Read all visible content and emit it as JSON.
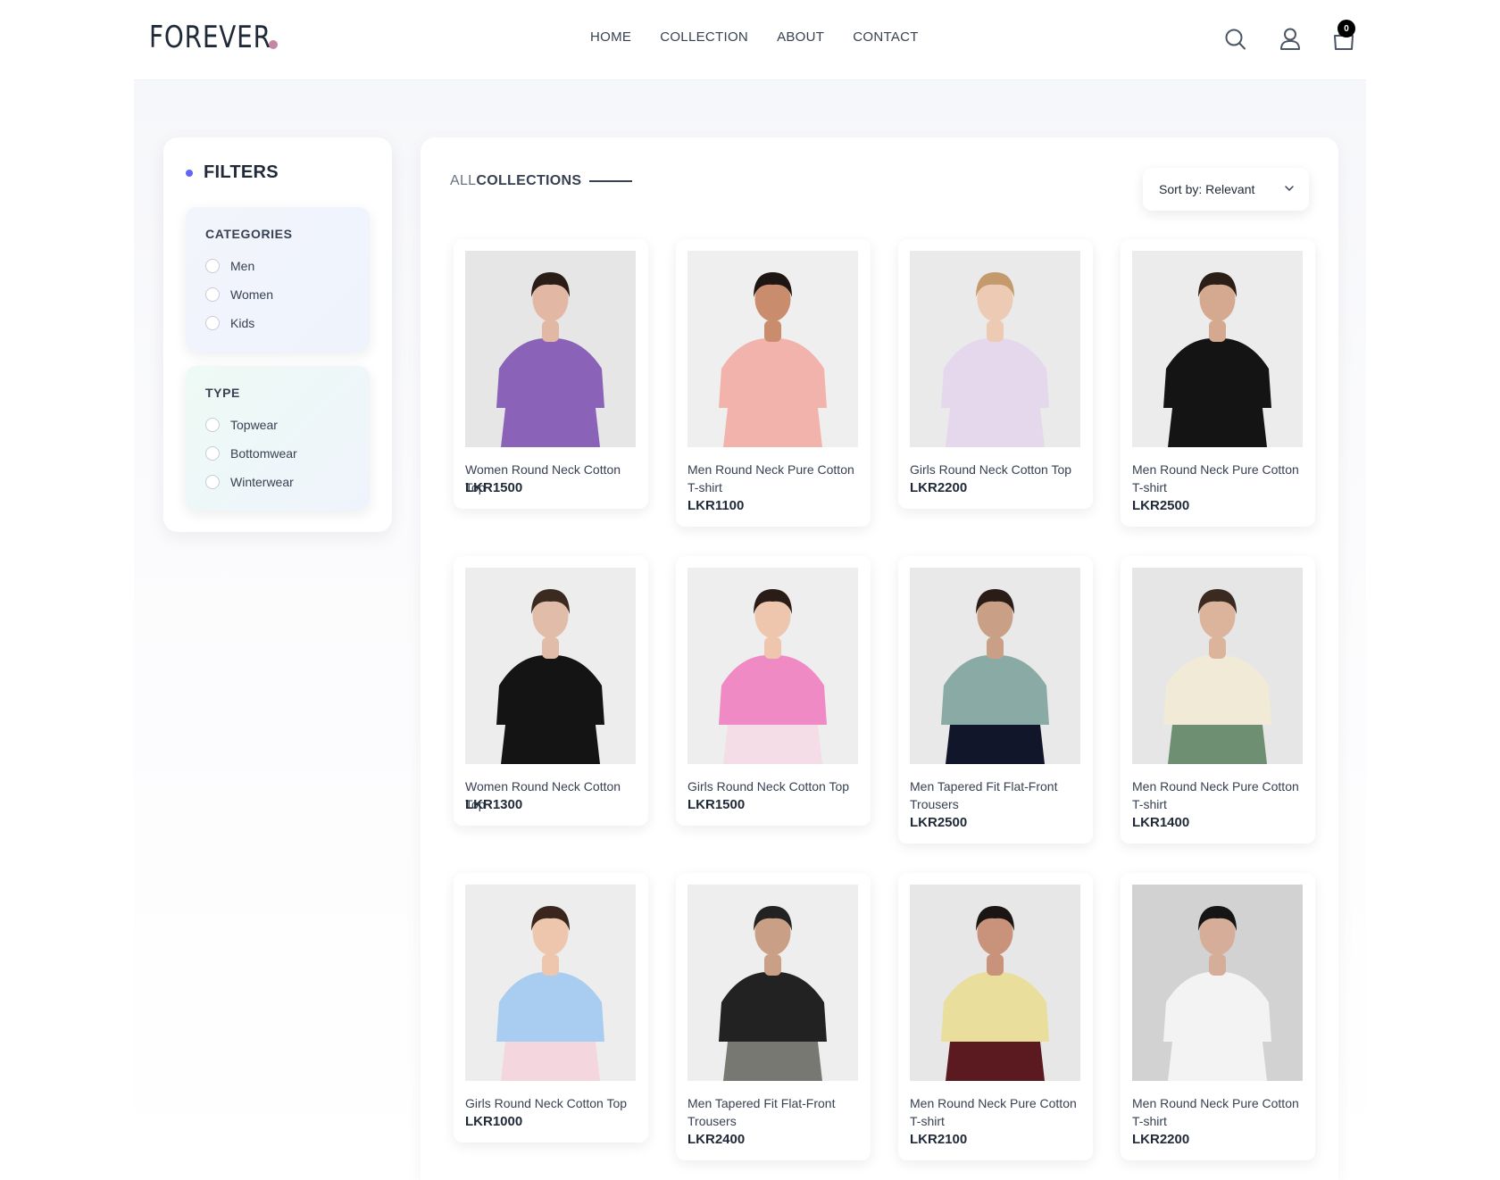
{
  "header": {
    "logo": "FOREVER",
    "nav": [
      "HOME",
      "COLLECTION",
      "ABOUT",
      "CONTACT"
    ],
    "cart_count": "0"
  },
  "filters": {
    "title": "FILTERS",
    "categories": {
      "heading": "CATEGORIES",
      "options": [
        "Men",
        "Women",
        "Kids"
      ]
    },
    "type": {
      "heading": "TYPE",
      "options": [
        "Topwear",
        "Bottomwear",
        "Winterwear"
      ]
    }
  },
  "collection": {
    "title_light": "ALL",
    "title_bold": "COLLECTIONS",
    "sort_label": "Sort by: Relevant"
  },
  "products": [
    {
      "name": "Women Round Neck Cotton Top",
      "price": "LKR1500",
      "bg": "#e6e6e6",
      "garment": "#8a63b8",
      "skin": "#e2b8a4",
      "hair": "#2a1d18",
      "lower": "#8a63b8"
    },
    {
      "name": "Men Round Neck Pure Cotton T-shirt",
      "price": "LKR1100",
      "bg": "#efefef",
      "garment": "#f2b3ad",
      "skin": "#c98d6d",
      "hair": "#1d1612",
      "lower": "#f2b3ad"
    },
    {
      "name": "Girls Round Neck Cotton Top",
      "price": "LKR2200",
      "bg": "#eaeaea",
      "garment": "#e6d8ec",
      "skin": "#eccab3",
      "hair": "#c49a6c",
      "lower": "#e6d8ec"
    },
    {
      "name": "Men Round Neck Pure Cotton T-shirt",
      "price": "LKR2500",
      "bg": "#ececec",
      "garment": "#141414",
      "skin": "#d5a98f",
      "hair": "#2b1e16",
      "lower": "#141414"
    },
    {
      "name": "Women Round Neck Cotton Top",
      "price": "LKR1300",
      "bg": "#ededed",
      "garment": "#141414",
      "skin": "#e1bca8",
      "hair": "#3a2a20",
      "lower": "#141414"
    },
    {
      "name": "Girls Round Neck Cotton Top",
      "price": "LKR1500",
      "bg": "#eeeeee",
      "garment": "#f08ac4",
      "skin": "#eec6ad",
      "hair": "#2a1d18",
      "lower": "#f4dde6"
    },
    {
      "name": "Men Tapered Fit Flat-Front Trousers",
      "price": "LKR2500",
      "bg": "#e9e9e9",
      "garment": "#8aaba5",
      "skin": "#c9a086",
      "hair": "#2a1d18",
      "lower": "#11162a"
    },
    {
      "name": "Men Round Neck Pure Cotton T-shirt",
      "price": "LKR1400",
      "bg": "#e6e6e6",
      "garment": "#f0ead6",
      "skin": "#dcb39b",
      "hair": "#3b2a20",
      "lower": "#6f8f72"
    },
    {
      "name": "Girls Round Neck Cotton Top",
      "price": "LKR1000",
      "bg": "#ededed",
      "garment": "#a9cdf0",
      "skin": "#eec6ad",
      "hair": "#3a261c",
      "lower": "#f4d6df"
    },
    {
      "name": "Men Tapered Fit Flat-Front Trousers",
      "price": "LKR2400",
      "bg": "#eeeeee",
      "garment": "#222222",
      "skin": "#c9a086",
      "hair": "#222222",
      "lower": "#787873"
    },
    {
      "name": "Men Round Neck Pure Cotton T-shirt",
      "price": "LKR2100",
      "bg": "#e7e7e7",
      "garment": "#e9de9c",
      "skin": "#c9927a",
      "hair": "#1b1513",
      "lower": "#5a1a1f"
    },
    {
      "name": "Men Round Neck Pure Cotton T-shirt",
      "price": "LKR2200",
      "bg": "#d2d2d2",
      "garment": "#f3f3f3",
      "skin": "#d6ad98",
      "hair": "#151515",
      "lower": "#f3f3f3"
    }
  ]
}
